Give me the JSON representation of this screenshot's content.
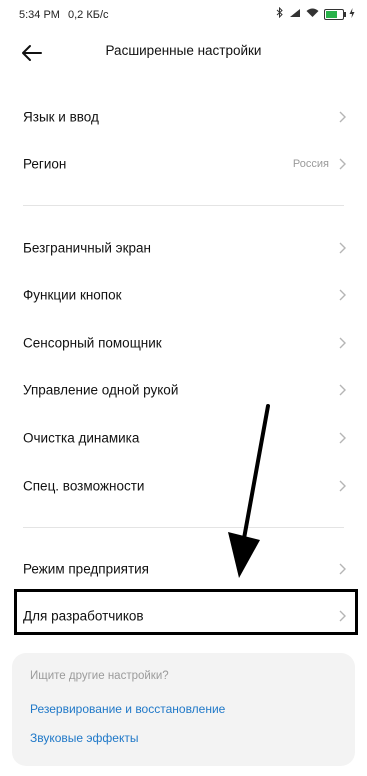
{
  "status_bar": {
    "time": "5:34 PM",
    "speed": "0,2 КБ/с",
    "icons": [
      "bluetooth-icon",
      "signal-icon",
      "wifi-icon",
      "battery-icon",
      "charging-icon"
    ]
  },
  "header": {
    "title": "Расширенные настройки"
  },
  "sections": [
    {
      "items": [
        {
          "label": "Язык и ввод"
        },
        {
          "label": "Регион",
          "value": "Россия"
        }
      ]
    },
    {
      "items": [
        {
          "label": "Безграничный экран"
        },
        {
          "label": "Функции кнопок"
        },
        {
          "label": "Сенсорный помощник"
        },
        {
          "label": "Управление одной рукой"
        },
        {
          "label": "Очистка динамика"
        },
        {
          "label": "Спец. возможности"
        }
      ]
    },
    {
      "items": [
        {
          "label": "Режим предприятия"
        },
        {
          "label": "Для разработчиков"
        }
      ]
    }
  ],
  "search_card": {
    "title": "Ищите другие настройки?",
    "links": [
      "Резервирование и восстановление",
      "Звуковые эффекты"
    ]
  },
  "colors": {
    "accent": "#1f78c8",
    "battery": "#29b24a"
  }
}
